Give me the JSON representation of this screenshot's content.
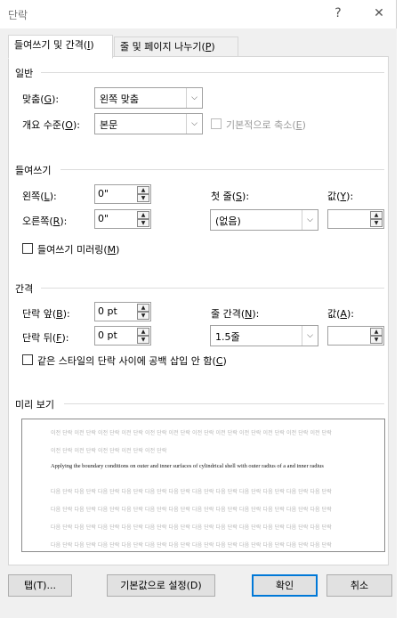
{
  "window": {
    "title": "단락",
    "help_label": "?",
    "close_label": "✕"
  },
  "tabs": [
    {
      "label": "들여쓰기 및 간격",
      "key": "I"
    },
    {
      "label": "줄 및 페이지 나누기",
      "key": "P"
    }
  ],
  "general": {
    "section_title": "일반",
    "alignment_label": "맞춤",
    "alignment_key": "G",
    "alignment_value": "왼쪽 맞춤",
    "outline_label": "개요 수준",
    "outline_key": "O",
    "outline_value": "본문",
    "collapsed_label": "기본적으로 축소",
    "collapsed_key": "E"
  },
  "indent": {
    "section_title": "들여쓰기",
    "left_label": "왼쪽",
    "left_key": "L",
    "left_value": "0\"",
    "right_label": "오른쪽",
    "right_key": "R",
    "right_value": "0\"",
    "special_label": "첫 줄",
    "special_key": "S",
    "special_value": "(없음)",
    "by_label": "값",
    "by_key": "Y",
    "by_value": "",
    "mirror_label": "들여쓰기 미러링",
    "mirror_key": "M"
  },
  "spacing": {
    "section_title": "간격",
    "before_label": "단락 앞",
    "before_key": "B",
    "before_value": "0 pt",
    "after_label": "단락 뒤",
    "after_key": "F",
    "after_value": "0 pt",
    "line_label": "줄 간격",
    "line_key": "N",
    "line_value": "1.5줄",
    "at_label": "값",
    "at_key": "A",
    "at_value": "",
    "no_space_label": "같은 스타일의 단락 사이에 공백 삽입 안 함",
    "no_space_key": "C"
  },
  "preview": {
    "section_title": "미리 보기",
    "prev_line_1": "이전 단락 이전 단락 이전 단락 이전 단락 이전 단락 이전 단락 이전 단락 이전 단락 이전 단락 이전 단락 이전 단락 이전 단락",
    "prev_line_2": "이전 단락 이전 단락 이전 단락 이전 단락 이전 단락",
    "sample_text": "Applying the boundary conditions on outer and inner surfaces of cylindrical shell with outer radius of a and inner radius",
    "next_line": "다음 단락 다음 단락 다음 단락 다음 단락 다음 단락 다음 단락 다음 단락 다음 단락 다음 단락 다음 단락 다음 단락 다음 단락"
  },
  "buttons": {
    "tabs_label": "탭(T)...",
    "default_label": "기본값으로 설정(D)",
    "ok_label": "확인",
    "cancel_label": "취소"
  }
}
